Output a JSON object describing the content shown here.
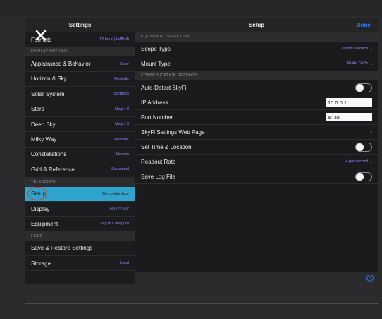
{
  "left": {
    "title": "Settings",
    "rows_top": [
      {
        "label": "Formats",
        "value": "12 hour (AM/PM)"
      }
    ],
    "display_section": "DISPLAY OPTIONS",
    "display_rows": [
      {
        "label": "Appearance & Behavior",
        "value": "Color"
      },
      {
        "label": "Horizon & Sky",
        "value": "Realistic"
      },
      {
        "label": "Solar System",
        "value": "Surfaces"
      },
      {
        "label": "Stars",
        "value": "Mag 4.8"
      },
      {
        "label": "Deep Sky",
        "value": "Mag 7.2"
      },
      {
        "label": "Milky Way",
        "value": "Realistic"
      },
      {
        "label": "Constellations",
        "value": "Modern"
      },
      {
        "label": "Grid & Reference",
        "value": "Equatorial"
      }
    ],
    "telescope_section": "TELESCOPE",
    "telescope_rows": [
      {
        "label": "Setup",
        "value": "Demo Interface"
      },
      {
        "label": "Display",
        "value": "FOV = 5.0º"
      },
      {
        "label": "Equipment",
        "value": "Tap to Configure"
      }
    ],
    "files_section": "FILES",
    "files_rows": [
      {
        "label": "Save & Restore Settings",
        "value": ""
      },
      {
        "label": "Storage",
        "value": "Local"
      }
    ]
  },
  "right": {
    "title": "Setup",
    "done": "Done",
    "equipment_section": "EQUIPMENT SELECTION",
    "scope_type_label": "Scope Type",
    "scope_type_value": "Demo Interface",
    "mount_type_label": "Mount Type",
    "mount_type_value": "Alt-Az. GoTo",
    "comm_section": "COMMUNICATION SETTINGS",
    "auto_detect_label": "Auto-Detect SkyFi",
    "ip_label": "IP Address",
    "ip_value": "10.0.0.1",
    "port_label": "Port Number",
    "port_value": "4030",
    "web_page_label": "SkyFi Settings Web Page",
    "set_time_label": "Set Time & Location",
    "readout_label": "Readout Rate",
    "readout_value": "4 per second",
    "log_label": "Save Log File",
    "info_glyph": "?"
  },
  "colors": {
    "selected_row": "#2ea4cf",
    "value_text": "#8f86ff",
    "done_blue": "#2a7fff",
    "annotation_circle": "#e13a2a"
  },
  "icons": [
    "close-icon",
    "chevron-right-icon",
    "info-icon"
  ]
}
